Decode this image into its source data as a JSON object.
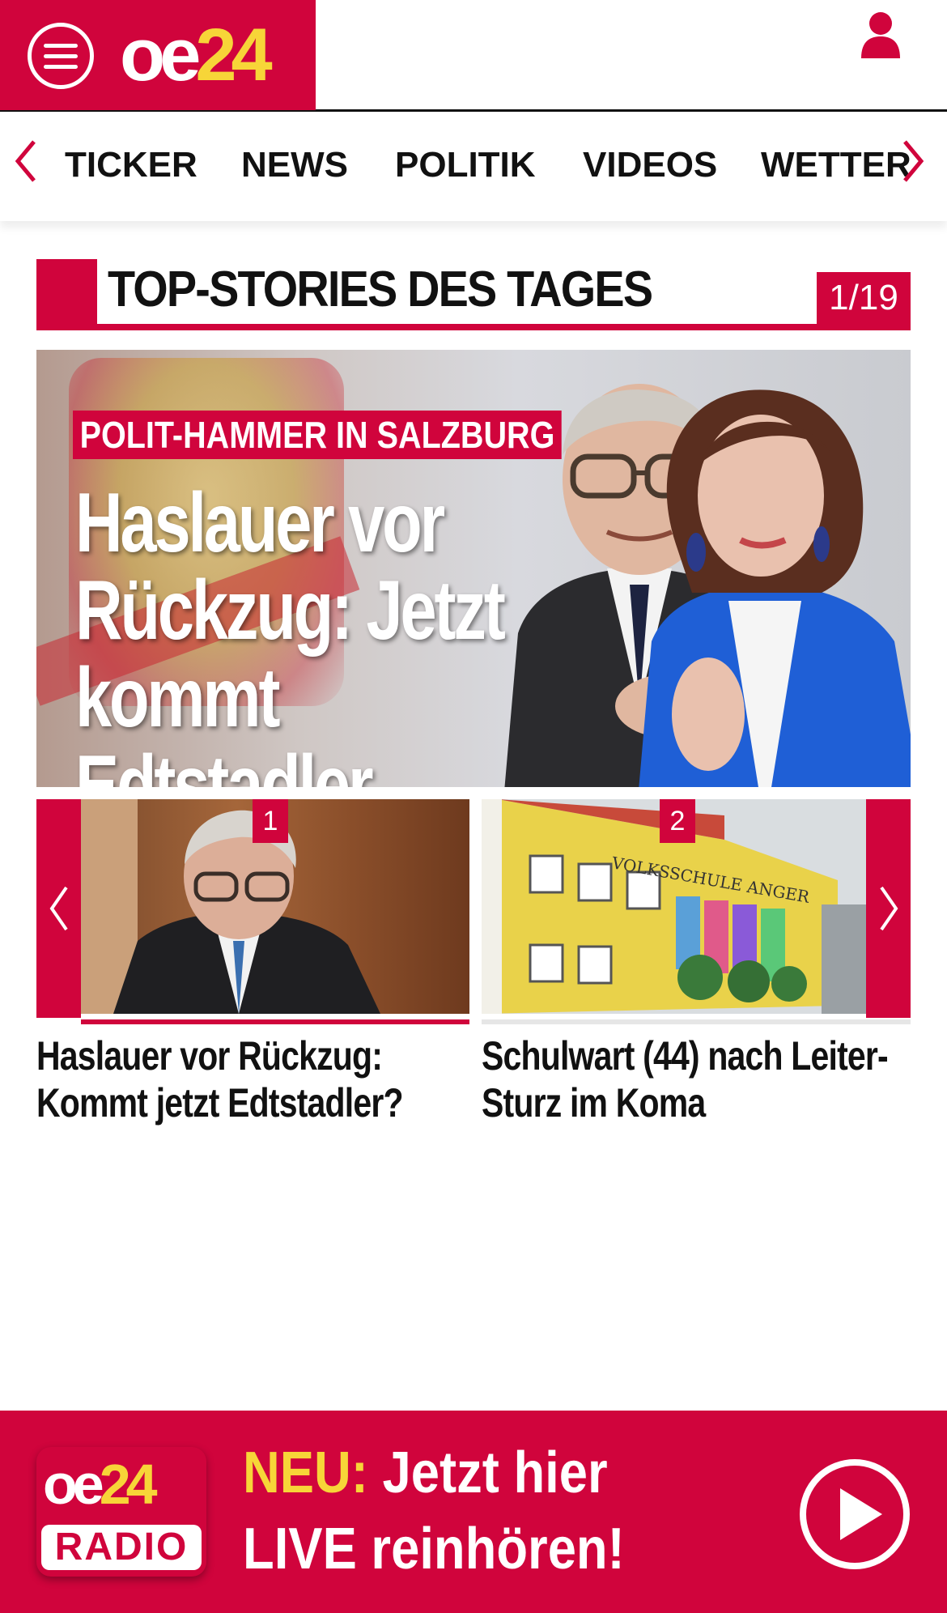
{
  "header": {
    "logo_part1": "oe",
    "logo_part2": "24",
    "menu_icon": "hamburger-menu-icon",
    "user_icon": "user-icon"
  },
  "nav": {
    "items": [
      "TICKER",
      "NEWS",
      "POLITIK",
      "VIDEOS",
      "WETTER"
    ]
  },
  "section": {
    "title": "TOP-STORIES DES TAGES",
    "counter": "1/19"
  },
  "hero": {
    "kicker": "POLIT-HAMMER IN SALZBURG",
    "headline_line1": "Haslauer vor",
    "headline_line2": "Rückzug: Jetzt",
    "headline_line3": "kommt Edtstadler"
  },
  "cards": [
    {
      "badge": "1",
      "title_line1": "Haslauer vor Rückzug:",
      "title_line2": "Kommt jetzt Edtstadler?"
    },
    {
      "badge": "2",
      "title_line1": "Schulwart (44) nach Leiter-",
      "title_line2": "Sturz im Koma",
      "sign_text": "VOLKSSCHULE ANGER"
    }
  ],
  "radio": {
    "logo_part1": "oe",
    "logo_part2": "24",
    "logo_label": "RADIO",
    "neu": "NEU:",
    "line1_rest": "Jetzt hier",
    "line2": "LIVE reinhören!",
    "play_icon": "play-icon"
  },
  "colors": {
    "brand_red": "#d0043c",
    "brand_yellow": "#f7d538"
  }
}
